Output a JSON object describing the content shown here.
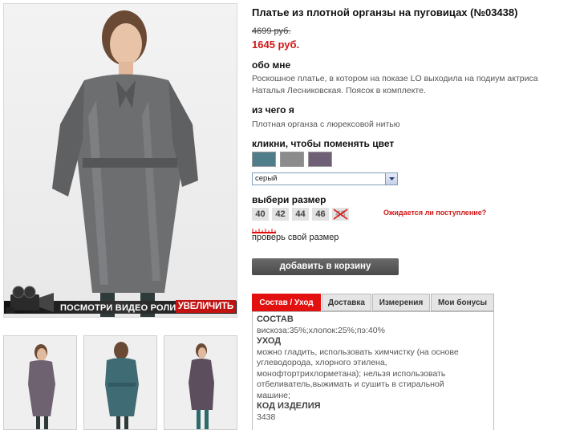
{
  "product": {
    "title": "Платье из плотной органзы на пуговицах (№03438)",
    "old_price": "4699 руб.",
    "new_price": "1645 руб."
  },
  "about": {
    "heading": "обо мне",
    "text_line1": "Роскошное платье, в котором на показе LO выходила на подиум актриса",
    "text_line2": "Наталья Лесниковская. Поясок в комплекте."
  },
  "material": {
    "heading": "из чего я",
    "text": "Плотная органза с люрексовой нитью"
  },
  "colors": {
    "heading": "кликни, чтобы поменять цвет",
    "swatches": [
      "#4f7d8a",
      "#8c8c8c",
      "#6f6078"
    ],
    "selected": "серый"
  },
  "sizes": {
    "heading": "выбери размер",
    "items": [
      "40",
      "42",
      "44",
      "46",
      "48"
    ],
    "unavailable": "48",
    "waiting_link": "Ожидается ли поступление?",
    "check_size": "проверь свой размер"
  },
  "cart_button": "добавить в корзину",
  "photo": {
    "video_label": "посмотри видео ролик",
    "zoom_label": "увеличить"
  },
  "tabs": [
    {
      "label": "Состав / Уход",
      "active": true
    },
    {
      "label": "Доставка",
      "active": false
    },
    {
      "label": "Измерения",
      "active": false
    },
    {
      "label": "Мои бонусы",
      "active": false
    }
  ],
  "tab_content": {
    "composition_heading": "СОСТАВ",
    "composition": "вискоза:35%;хлопок:25%;пэ:40%",
    "care_heading": "УХОД",
    "care_line1": "можно гладить, использовать химчистку (на основе",
    "care_line2": "углеводорода, хлорного этилена,",
    "care_line3": "монофтортрихлорметана); нельзя использовать",
    "care_line4": "отбеливатель,выжимать и сушить в стиральной",
    "care_line5": "машине;",
    "code_heading": "КОД ИЗДЕЛИЯ",
    "code": "3438"
  }
}
